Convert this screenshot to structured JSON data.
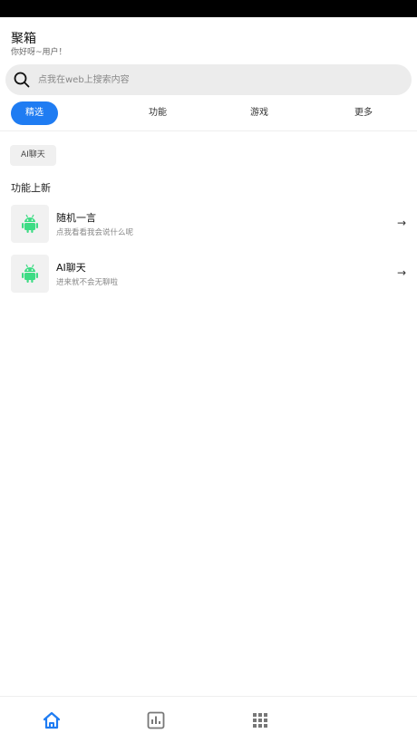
{
  "app": {
    "title": "聚箱",
    "subtitle": "你好呀~用户！"
  },
  "search": {
    "placeholder": "点我在web上搜索内容",
    "icon": "search-icon"
  },
  "tabs": [
    {
      "label": "精选",
      "active": true
    },
    {
      "label": "功能",
      "active": false
    },
    {
      "label": "游戏",
      "active": false
    },
    {
      "label": "更多",
      "active": false
    }
  ],
  "tags": [
    {
      "label": "AI聊天"
    }
  ],
  "section": {
    "title": "功能上新"
  },
  "items": [
    {
      "title": "随机一言",
      "desc": "点我看看我会说什么呢",
      "icon": "android-icon"
    },
    {
      "title": "AI聊天",
      "desc": "进来就不会无聊啦",
      "icon": "android-icon"
    }
  ],
  "bottom_nav": [
    {
      "icon": "home-icon",
      "active": true
    },
    {
      "icon": "chart-icon",
      "active": false
    },
    {
      "icon": "grid-icon",
      "active": false
    }
  ],
  "colors": {
    "accent": "#1f7cf2",
    "android_green": "#3ddc84"
  }
}
